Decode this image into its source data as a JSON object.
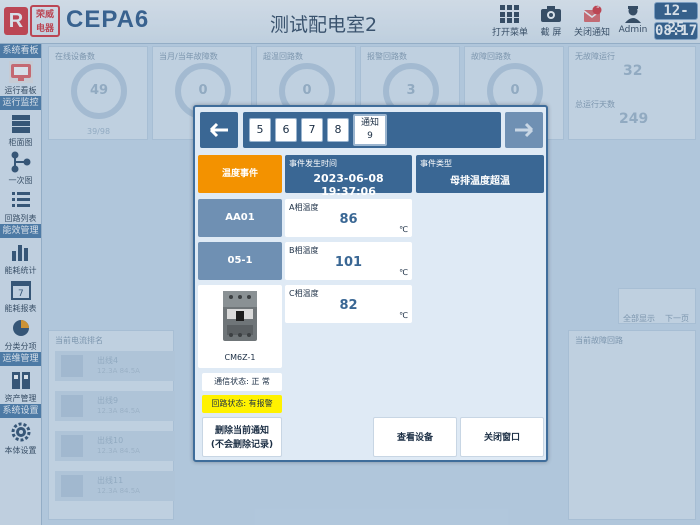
{
  "header": {
    "logo_letter": "R",
    "logo_text": "荣威\n电器",
    "app_title": "CEPA6",
    "page_title": "测试配电室2",
    "buttons": {
      "open_menu": "打开菜单",
      "screenshot": "截 屏",
      "close_notify": "关闭通知",
      "notify_count": "9",
      "admin": "Admin"
    },
    "date": "12-25",
    "time": "08:17"
  },
  "sidebar": {
    "sections": [
      "系统看板",
      "运行监控",
      "能效管理",
      "运维管理",
      "系统设置"
    ],
    "items": [
      "运行看板",
      "柜面图",
      "一次图",
      "回路列表",
      "能耗统计",
      "能耗报表",
      "分类分项",
      "资产管理",
      "本体设置"
    ]
  },
  "dashboard": {
    "cards": [
      "在线设备数",
      "当月/当年故障数",
      "超温回路数",
      "报警回路数",
      "故障回路数",
      "无故障运行",
      "总运行天数"
    ],
    "gauge_values": [
      "49",
      "0",
      "0",
      "3",
      "0"
    ],
    "online_ratio": "39/98",
    "days_safe": "32",
    "days_total": "249",
    "current_rank": "当前电流排名",
    "fault_loops": "当前故障回路",
    "rows": [
      {
        "name": "出线4",
        "sub": "12.3A 84.5A"
      },
      {
        "name": "出线9",
        "sub": "12.3A 84.5A"
      },
      {
        "name": "出线10",
        "sub": "12.3A 84.5A"
      },
      {
        "name": "出线11",
        "sub": "12.3A 84.5A"
      }
    ],
    "page_ctrl": [
      "全部显示",
      "下一页"
    ]
  },
  "modal": {
    "pages": [
      "5",
      "6",
      "7",
      "8"
    ],
    "current_page_label": "通知",
    "current_page_num": "9",
    "event_label": "温度事件",
    "time_label": "事件发生时间",
    "time_value": "2023-06-08 19:37:06",
    "type_label": "事件类型",
    "type_value": "母排温度超温",
    "cabinet": "AA01",
    "loop": "05-1",
    "device_model": "CM6Z-1",
    "comm_status": "通信状态: 正  常",
    "loop_status": "回路状态: 有报警",
    "phases": [
      {
        "label": "A相温度",
        "value": "86",
        "unit": "℃"
      },
      {
        "label": "B相温度",
        "value": "101",
        "unit": "℃"
      },
      {
        "label": "C相温度",
        "value": "82",
        "unit": "℃"
      }
    ],
    "delete_btn_line1": "删除当前通知",
    "delete_btn_line2": "(不会删除记录)",
    "view_btn": "查看设备",
    "close_btn": "关闭窗口"
  },
  "colors": {
    "accent": "#3a6794",
    "event_orange": "#f39200",
    "warn_yellow": "#fff200"
  }
}
